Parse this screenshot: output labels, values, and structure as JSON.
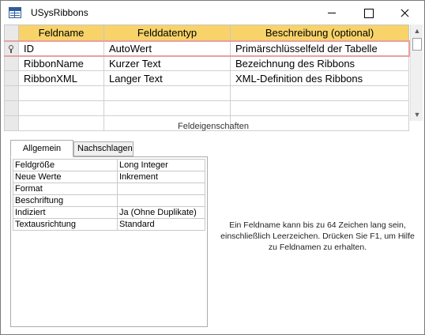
{
  "window": {
    "title": "USysRibbons"
  },
  "grid": {
    "columns": [
      "Feldname",
      "Felddatentyp",
      "Beschreibung (optional)"
    ],
    "rows": [
      {
        "name": "ID",
        "type": "AutoWert",
        "description": "Primärschlüsselfeld der Tabelle",
        "primary_key": true
      },
      {
        "name": "RibbonName",
        "type": "Kurzer Text",
        "description": "Bezeichnung des Ribbons"
      },
      {
        "name": "RibbonXML",
        "type": "Langer Text",
        "description": "XML-Definition des Ribbons"
      }
    ]
  },
  "properties": {
    "section_title": "Feldeigenschaften",
    "tabs": [
      "Allgemein",
      "Nachschlagen"
    ],
    "active_tab": "Allgemein",
    "rows": [
      {
        "label": "Feldgröße",
        "value": "Long Integer"
      },
      {
        "label": "Neue Werte",
        "value": "Inkrement"
      },
      {
        "label": "Format",
        "value": ""
      },
      {
        "label": "Beschriftung",
        "value": ""
      },
      {
        "label": "Indiziert",
        "value": "Ja (Ohne Duplikate)"
      },
      {
        "label": "Textausrichtung",
        "value": "Standard"
      }
    ],
    "help_text": "Ein Feldname kann bis zu 64 Zeichen lang sein, einschließlich Leerzeichen. Drücken Sie F1, um Hilfe zu Feldnamen zu erhalten."
  },
  "icons": {
    "title": "table-icon",
    "key": "primary-key-icon"
  },
  "colors": {
    "header": "#f7d36a",
    "current_row_border": "#e8a0a0"
  }
}
